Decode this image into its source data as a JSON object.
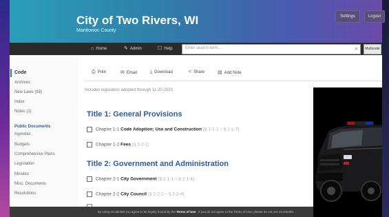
{
  "header": {
    "title": "City of Two Rivers, WI",
    "subtitle": "Manitowoc County",
    "settings_label": "Settings",
    "logout_label": "Logout"
  },
  "nav": {
    "home_label": "Home",
    "admin_label": "Admin",
    "help_label": "Help",
    "search_placeholder": "Enter search term...",
    "multicode_label": "Multicode"
  },
  "sidebar": {
    "code_label": "Code",
    "code_links": [
      "Archives",
      "New Laws (93)",
      "Index",
      "Notes (1)"
    ],
    "public_docs_label": "Public Documents",
    "doc_links": [
      "Agendas",
      "Budgets",
      "Comprehensive Plans",
      "Legislation",
      "Minutes",
      "Misc. Documents",
      "Resolutions"
    ]
  },
  "toolbar": {
    "print_label": "Print",
    "email_label": "Email",
    "download_label": "Download",
    "share_label": "Share",
    "addnote_label": "Add Note"
  },
  "content": {
    "note": "Includes legislation adopted through 11-20-2020.",
    "title1": "Title 1: General Provisions",
    "title2": "Title 2: Government and Administration",
    "chapters": [
      {
        "num": "Chapter 1-1",
        "name": "Code Adoption; Use and Construction",
        "sections": "(§ 1-1-1 – § 1-1-7)"
      },
      {
        "num": "Chapter 1-2",
        "name": "Fees",
        "sections": "(§ 1-2-1)"
      },
      {
        "num": "Chapter 2-1",
        "name": "City Government",
        "sections": "(§ 2-1-1 – § 2-1-4)"
      },
      {
        "num": "Chapter 2-2",
        "name": "City Council",
        "sections": "(§ 2-2-1 – § 2-2-4)"
      }
    ]
  },
  "footer": {
    "text_before": "By using eCode360 you agree to be legally bound by the",
    "terms_label": "Terms of Use",
    "text_after": ". If you do not agree to the Terms of Use, please do not use eCode360."
  },
  "colors": {
    "header_start": "#2a9fb8",
    "header_end": "#6a4aa8",
    "nav_bg": "#2b2b2b",
    "heading_blue": "#2a5aa0"
  },
  "icons": [
    "home-icon",
    "admin-icon",
    "help-icon",
    "search-icon",
    "print-icon",
    "email-icon",
    "download-icon",
    "share-icon",
    "note-icon",
    "checkbox-icon"
  ]
}
